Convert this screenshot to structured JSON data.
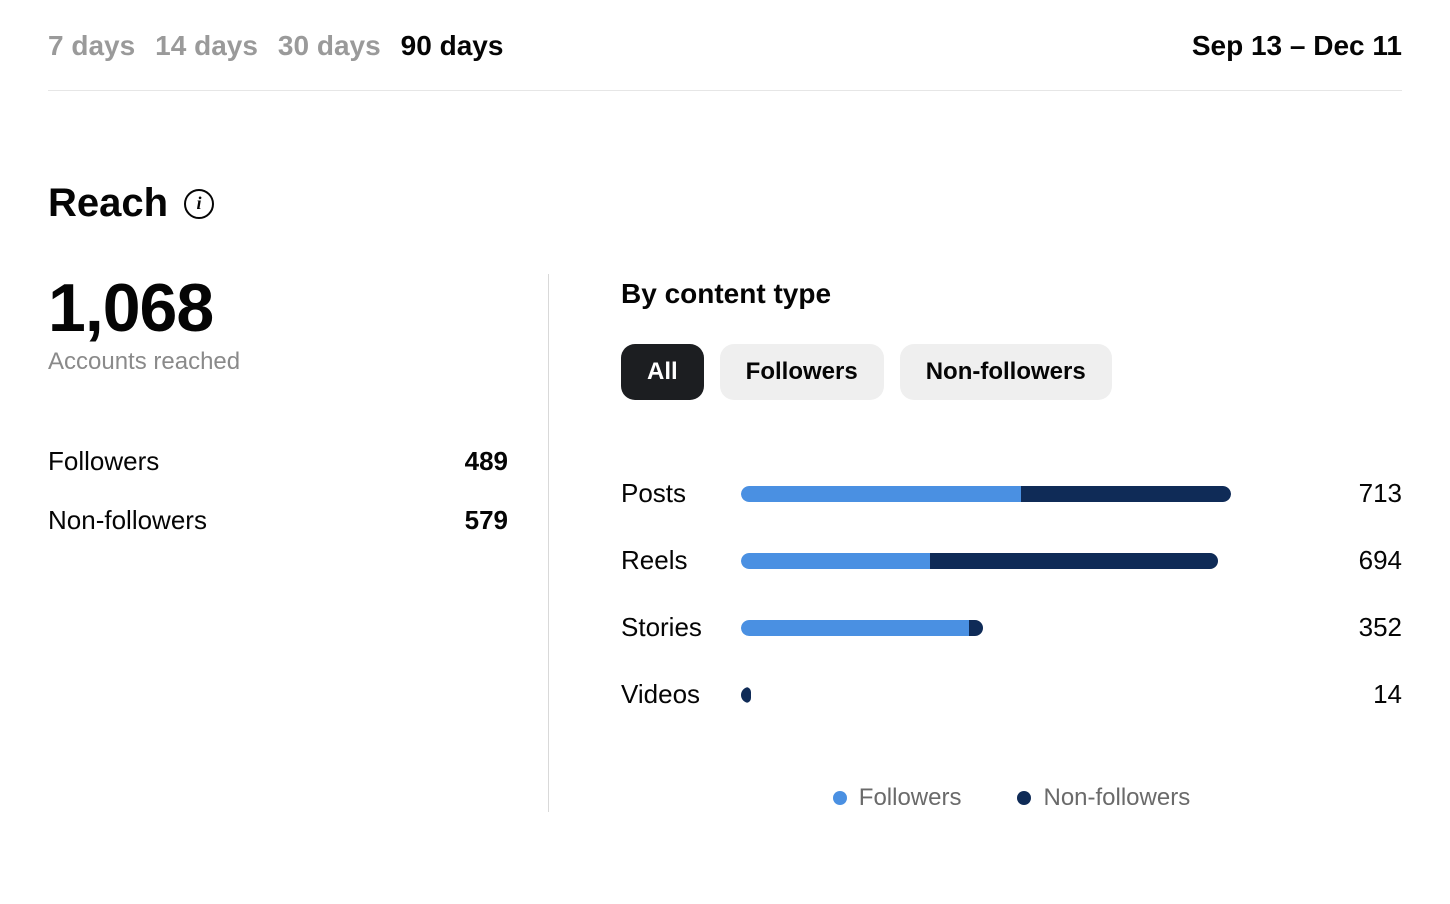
{
  "time_tabs": {
    "items": [
      "7 days",
      "14 days",
      "30 days",
      "90 days"
    ],
    "active_index": 3
  },
  "date_range": "Sep 13 – Dec 11",
  "section": {
    "title": "Reach",
    "big_number": "1,068",
    "big_label": "Accounts reached",
    "breakdown": [
      {
        "label": "Followers",
        "value": "489"
      },
      {
        "label": "Non-followers",
        "value": "579"
      }
    ]
  },
  "content_type": {
    "subhead": "By content type",
    "pills": [
      "All",
      "Followers",
      "Non-followers"
    ],
    "active_pill": 0
  },
  "legend": {
    "followers": "Followers",
    "nonfollowers": "Non-followers"
  },
  "chart_data": {
    "type": "bar",
    "orientation": "horizontal",
    "stacked": true,
    "max": 713,
    "categories": [
      "Posts",
      "Reels",
      "Stories",
      "Videos"
    ],
    "series": [
      {
        "name": "Followers",
        "color": "#4a90e2",
        "values": [
          408,
          275,
          332,
          0
        ]
      },
      {
        "name": "Non-followers",
        "color": "#0f2b57",
        "values": [
          305,
          419,
          20,
          14
        ]
      }
    ],
    "totals": [
      713,
      694,
      352,
      14
    ]
  }
}
